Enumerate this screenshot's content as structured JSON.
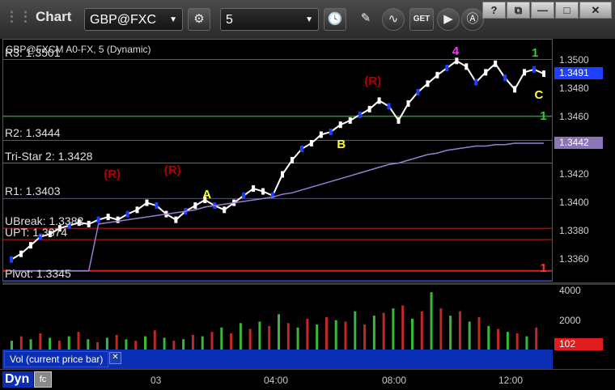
{
  "window": {
    "title": "Chart",
    "symbol": "GBP@FXC",
    "interval": "5",
    "buttons": [
      "settings",
      "clock",
      "draw",
      "indicators",
      "get",
      "play",
      "analytics"
    ],
    "get_label": "GET",
    "win_help": "?",
    "win_min": "—",
    "win_max": "□",
    "win_close": "✕"
  },
  "chart": {
    "caption": "GBP@FXCM A0-FX, 5 (Dynamic)",
    "levels": [
      {
        "label": "R3: 1.3501",
        "price": 1.3501,
        "color": "#2e4fff"
      },
      {
        "label": "R2: 1.3444",
        "price": 1.3444,
        "color": "#2e4fff"
      },
      {
        "label": "Tri-Star 2: 1.3428",
        "price": 1.3428,
        "color": "#23a323"
      },
      {
        "label": "R1: 1.3403",
        "price": 1.3403,
        "color": "#2e4fff"
      },
      {
        "label": "UBreak: 1.3382",
        "price": 1.3382,
        "color": "#c81e1e"
      },
      {
        "label": "UPT: 1.3374",
        "price": 1.3374,
        "color": "#c81e1e"
      },
      {
        "label": "Pivot: 1.3345",
        "price": 1.3345,
        "color": "#2e4fff"
      }
    ],
    "green_level": 1.3461,
    "red_level": 1.3352,
    "markers": [
      {
        "text": "(R)",
        "color": "#b00000",
        "x": 0.195,
        "price": 1.3419
      },
      {
        "text": "(R)",
        "color": "#b00000",
        "x": 0.305,
        "price": 1.3422
      },
      {
        "text": "(R)",
        "color": "#b00000",
        "x": 0.67,
        "price": 1.3485
      },
      {
        "text": "A",
        "color": "#ffff33",
        "x": 0.375,
        "price": 1.3405
      },
      {
        "text": "B",
        "color": "#ffff33",
        "x": 0.62,
        "price": 1.344
      },
      {
        "text": "C",
        "color": "#ffff33",
        "x": 0.98,
        "price": 1.3475
      },
      {
        "text": "4",
        "color": "#ff33ff",
        "x": 0.83,
        "price": 1.3506
      },
      {
        "text": "1",
        "color": "#33cc33",
        "x": 0.975,
        "price": 1.3505
      },
      {
        "text": "1",
        "color": "#33cc33",
        "x": 0.99,
        "price": 1.346
      },
      {
        "text": "1",
        "color": "#ff3333",
        "x": 0.99,
        "price": 1.3353
      }
    ],
    "price_axis": {
      "labels": [
        "1.3500",
        "1.3480",
        "1.3460",
        "1.3440",
        "1.3420",
        "1.3400",
        "1.3380",
        "1.3360"
      ],
      "last_price": "1.3491",
      "ma_price": "1.3442"
    }
  },
  "chart_data": {
    "type": "line",
    "title": "",
    "x_axis_labels": [
      "03",
      "04:00",
      "08:00",
      "12:00"
    ],
    "y_axis_range": [
      1.3345,
      1.3515
    ],
    "series": [
      {
        "values": [
          1.336,
          1.3364,
          1.337,
          1.3376,
          1.3378,
          1.3382,
          1.3384,
          1.3386,
          1.3385,
          1.3388,
          1.339,
          1.3388,
          1.3392,
          1.3395,
          1.34,
          1.3398,
          1.3392,
          1.3388,
          1.3394,
          1.3398,
          1.3402,
          1.3398,
          1.3395,
          1.34,
          1.3405,
          1.341,
          1.3408,
          1.3405,
          1.342,
          1.343,
          1.3438,
          1.3442,
          1.3448,
          1.345,
          1.3455,
          1.3458,
          1.3462,
          1.3466,
          1.3472,
          1.3468,
          1.3458,
          1.347,
          1.3478,
          1.3484,
          1.349,
          1.3495,
          1.35,
          1.3496,
          1.3485,
          1.3492,
          1.3498,
          1.3488,
          1.348,
          1.3492,
          1.3494,
          1.3491
        ]
      },
      {
        "values": [
          1.3352,
          1.3352,
          1.3352,
          1.3352,
          1.3352,
          1.3352,
          1.3352,
          1.3352,
          1.3352,
          1.3385,
          1.3386,
          1.3387,
          1.3388,
          1.3389,
          1.339,
          1.3391,
          1.3392,
          1.3393,
          1.3394,
          1.3395,
          1.3397,
          1.3398,
          1.3399,
          1.34,
          1.3401,
          1.3402,
          1.3403,
          1.3404,
          1.3406,
          1.3407,
          1.3409,
          1.3411,
          1.3413,
          1.3415,
          1.3417,
          1.3419,
          1.3421,
          1.3423,
          1.3425,
          1.3427,
          1.3428,
          1.343,
          1.3432,
          1.3434,
          1.3435,
          1.3437,
          1.3438,
          1.3439,
          1.344,
          1.344,
          1.3441,
          1.3441,
          1.3442,
          1.3442,
          1.3442,
          1.3442
        ]
      }
    ],
    "volume": {
      "axis_labels": [
        "4000",
        "2000"
      ],
      "last_label": "102",
      "range": [
        0,
        4400
      ],
      "values": [
        600,
        900,
        700,
        1100,
        800,
        600,
        900,
        1200,
        700,
        500,
        800,
        1000,
        700,
        600,
        900,
        1300,
        800,
        600,
        700,
        1000,
        900,
        1200,
        1500,
        1100,
        1800,
        1400,
        1900,
        1600,
        2400,
        1800,
        1500,
        2100,
        1700,
        2200,
        2000,
        1900,
        2600,
        1700,
        2300,
        2500,
        2800,
        3000,
        2100,
        2600,
        3900,
        2800,
        2300,
        2600,
        1900,
        2200,
        1600,
        1400,
        1200,
        1100,
        900,
        1500
      ]
    }
  },
  "vol_pane": {
    "label": "Vol (current price bar)",
    "close": "✕"
  },
  "footer": {
    "dyn_label": "Dyn",
    "time_labels": [
      "03",
      "04:00",
      "08:00",
      "12:00"
    ]
  }
}
